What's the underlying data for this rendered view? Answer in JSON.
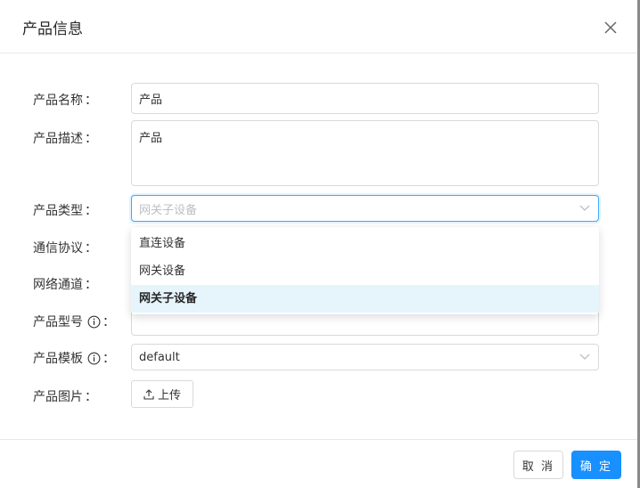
{
  "dialog": {
    "title": "产品信息",
    "close_icon": "close-icon"
  },
  "form": {
    "name": {
      "label": "产品名称",
      "value": "产品"
    },
    "description": {
      "label": "产品描述",
      "value": "产品"
    },
    "type": {
      "label": "产品类型",
      "selected": "网关子设备",
      "options": [
        "直连设备",
        "网关设备",
        "网关子设备"
      ]
    },
    "protocol": {
      "label": "通信协议"
    },
    "channel": {
      "label": "网络通道"
    },
    "model": {
      "label": "产品型号",
      "value": ""
    },
    "template": {
      "label": "产品模板",
      "value": "default"
    },
    "image": {
      "label": "产品图片",
      "upload_label": "上传"
    },
    "colon": "："
  },
  "footer": {
    "cancel_label": "取 消",
    "ok_label": "确 定"
  },
  "colors": {
    "primary": "#1890ff",
    "selected_option_bg": "#e6f4fc",
    "border": "#d9d9d9"
  }
}
